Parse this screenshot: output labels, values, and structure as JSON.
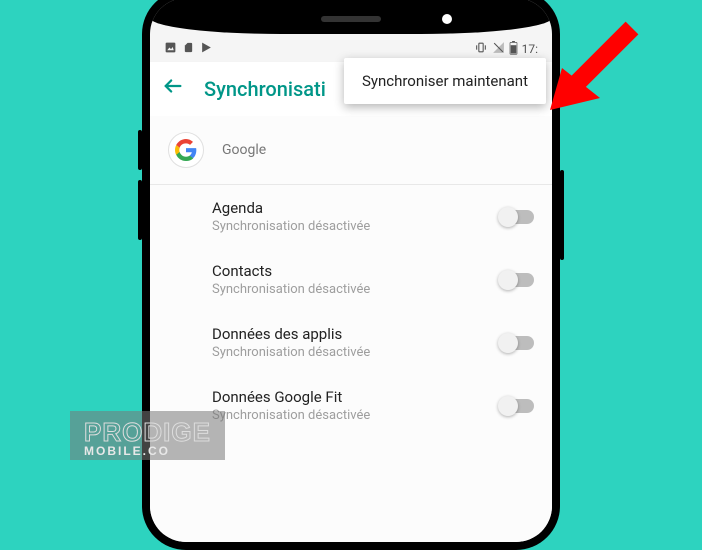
{
  "statusbar": {
    "time": "17:"
  },
  "appbar": {
    "title": "Synchronisati"
  },
  "popup": {
    "sync_now": "Synchroniser maintenant"
  },
  "account": {
    "provider": "Google"
  },
  "items": [
    {
      "title": "Agenda",
      "subtitle": "Synchronisation désactivée"
    },
    {
      "title": "Contacts",
      "subtitle": "Synchronisation désactivée"
    },
    {
      "title": "Données des applis",
      "subtitle": "Synchronisation désactivée"
    },
    {
      "title": "Données Google Fit",
      "subtitle": "Synchronisation désactivée"
    }
  ],
  "watermark": {
    "main": "PRODIGE",
    "sub": "MOBILE.CO"
  }
}
